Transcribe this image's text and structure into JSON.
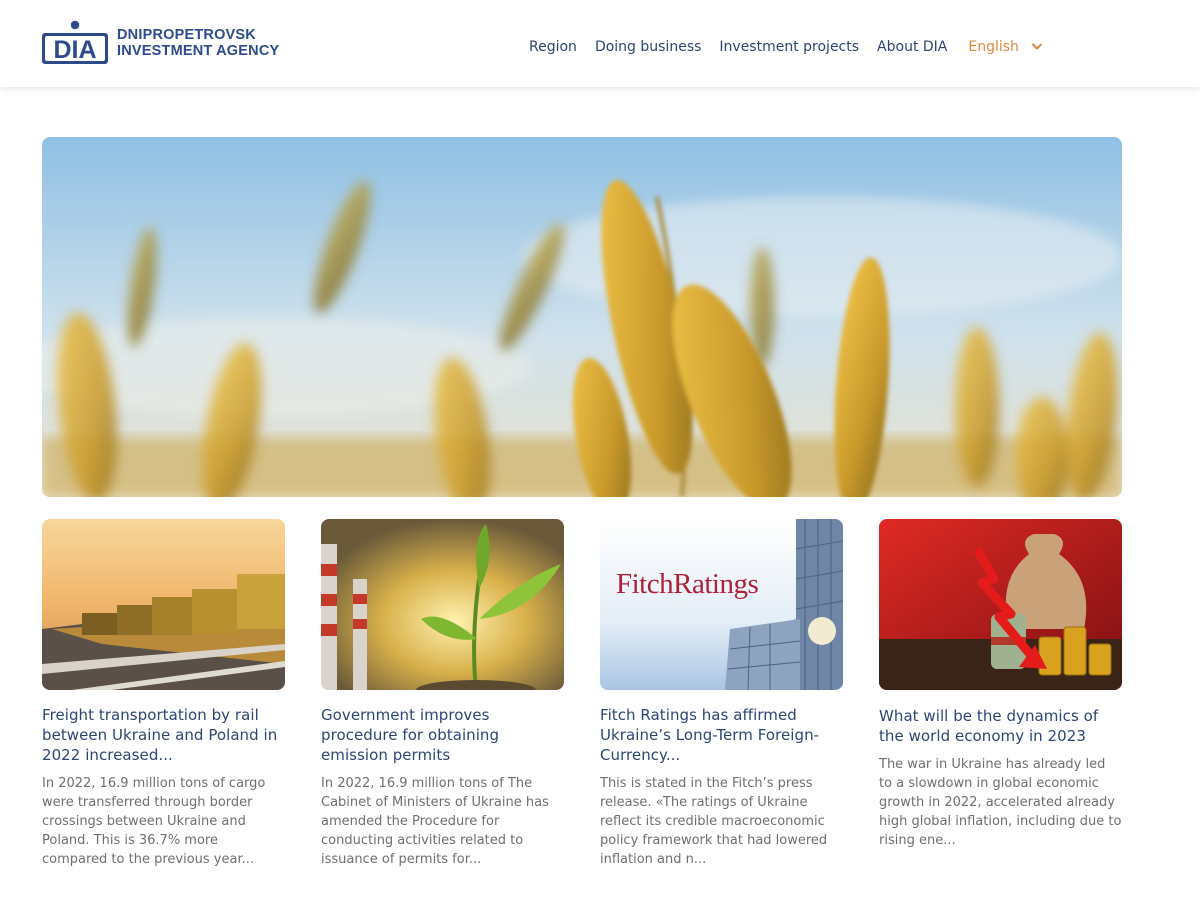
{
  "header": {
    "logo": {
      "mark_text": "DIA",
      "line1": "DNIPROPETROVSK",
      "line2": "INVESTMENT AGENCY"
    },
    "nav": [
      {
        "label": "Region"
      },
      {
        "label": "Doing business"
      },
      {
        "label": "Investment projects"
      },
      {
        "label": "About DIA"
      }
    ],
    "language": {
      "selected": "English",
      "icon": "chevron-down-icon"
    }
  },
  "hero": {
    "image": "wheat-field-sky"
  },
  "cards": [
    {
      "image": "freight-train",
      "title": "Freight transportation by rail between Ukraine and Poland in 2022 increased...",
      "text": "In 2022, 16.9 million tons of cargo were transferred through border crossings between Ukraine and Poland. This is 36.7% more compared to the previous year..."
    },
    {
      "image": "factory-chimneys-and-sprout",
      "title": "Government improves procedure for obtaining emission permits",
      "text": "In 2022, 16.9 million tons of The Cabinet of Ministers of Ukraine has amended the Procedure for conducting activities related to issuance of permits for..."
    },
    {
      "image": "fitch-ratings-building",
      "image_text": "FitchRatings",
      "title": "Fitch Ratings has affirmed Ukraine’s Long-Term Foreign-Currency...",
      "text": "This is stated in the Fitch’s press release. «The ratings of Ukraine reflect its credible macroeconomic policy framework that had lowered inflation and n..."
    },
    {
      "image": "money-bag-falling-arrow",
      "title": "What will be the dynamics of the world economy in 2023",
      "text": "The war in Ukraine has already led to a slowdown in global economic growth in 2022, accelerated already high global inflation, including due to rising ene..."
    }
  ],
  "colors": {
    "brand": "#2e4a8c",
    "accent": "#d88a3d",
    "text_muted": "#6f6f6f"
  }
}
